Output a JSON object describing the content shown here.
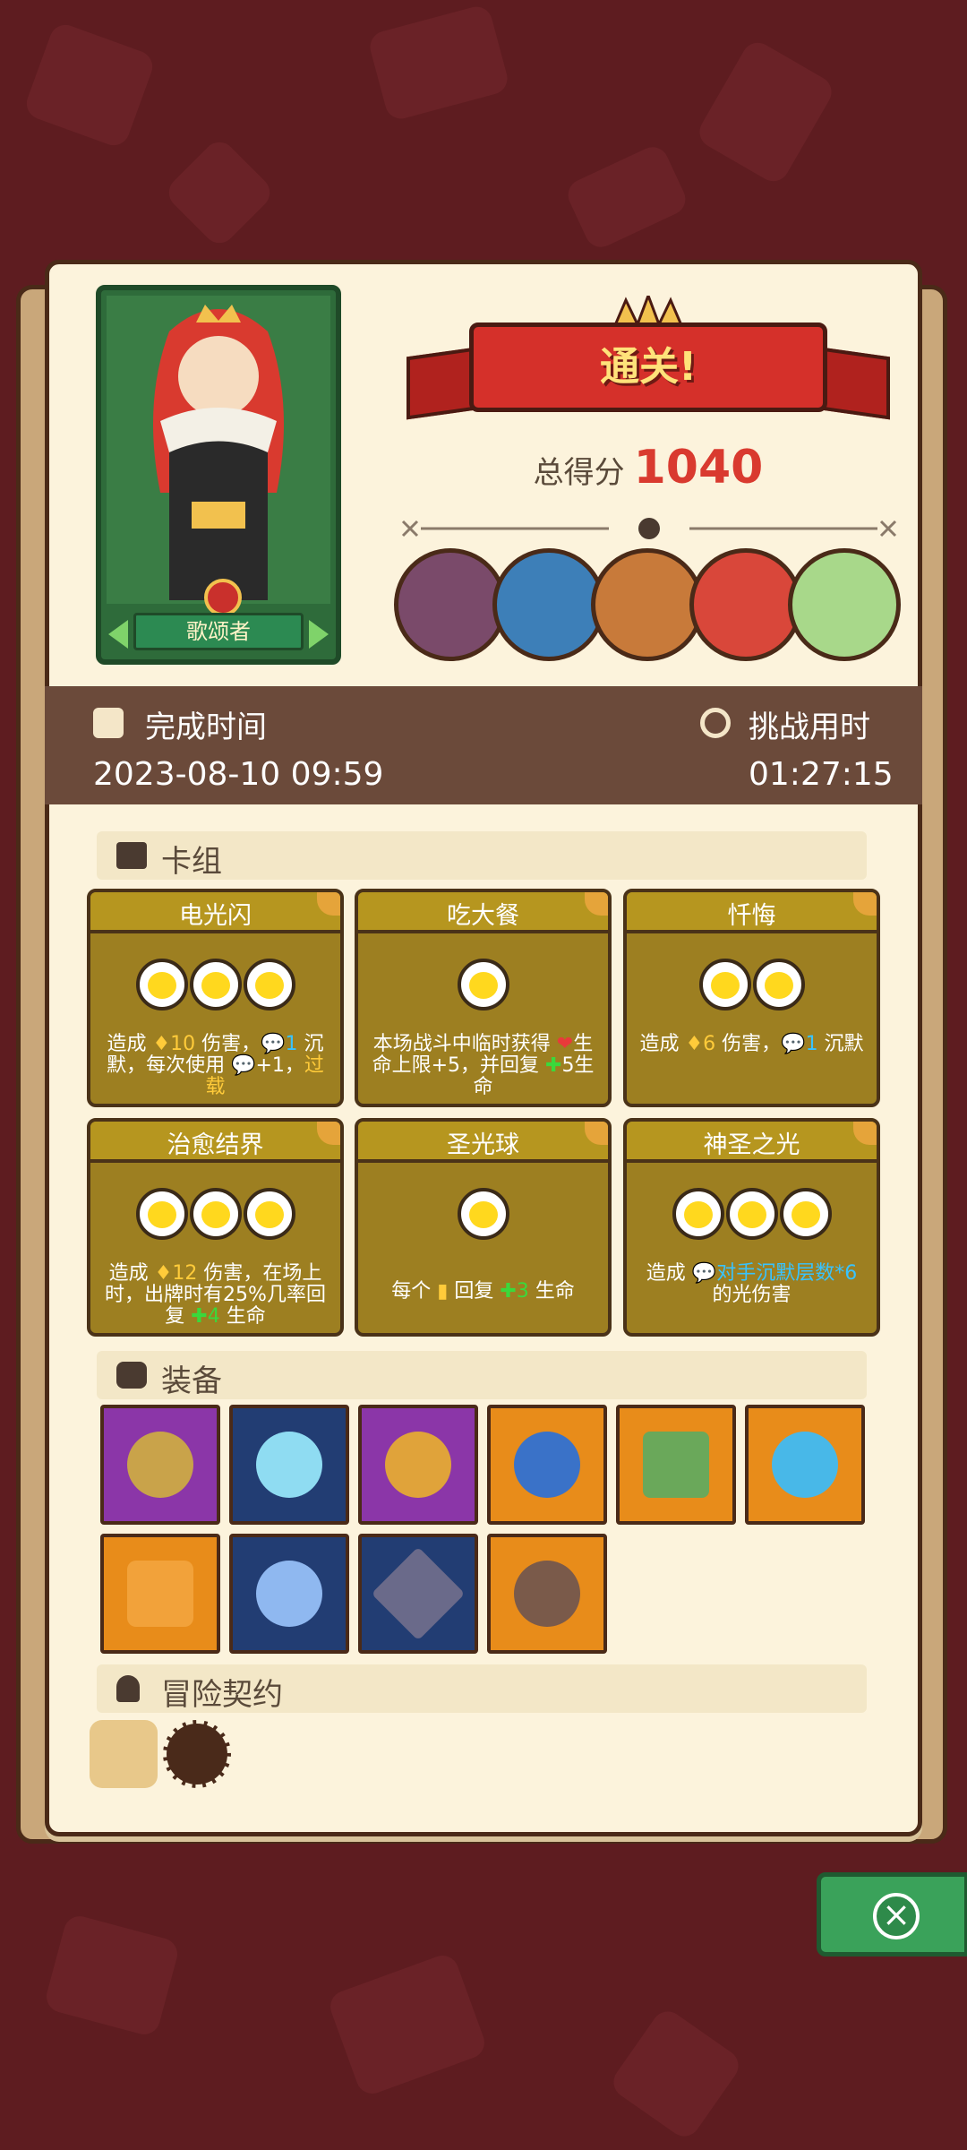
{
  "hero": {
    "name": "歌颂者"
  },
  "result": {
    "banner": "通关!",
    "score_label": "总得分",
    "score_value": "1040"
  },
  "bosses": [
    "boss-1",
    "boss-2",
    "boss-3",
    "boss-4",
    "boss-5"
  ],
  "time": {
    "complete_label": "完成时间",
    "complete_value": "2023-08-10 09:59",
    "challenge_label": "挑战用时",
    "challenge_value": "01:27:15"
  },
  "sections": {
    "deck": "卡组",
    "equipment": "装备",
    "contract": "冒险契约"
  },
  "cards": [
    {
      "name": "电光闪",
      "coins": 3
    },
    {
      "name": "吃大餐",
      "coins": 1
    },
    {
      "name": "忏悔",
      "coins": 2
    },
    {
      "name": "治愈结界",
      "coins": 3
    },
    {
      "name": "圣光球",
      "coins": 1
    },
    {
      "name": "神圣之光",
      "coins": 3
    }
  ],
  "card_desc": {
    "c0_a": "造成 ",
    "c0_n": "♦10",
    "c0_b": " 伤害，",
    "c0_s": "💬1",
    "c0_c": " 沉默，每次使用 ",
    "c0_s2": "💬",
    "c0_d": "+1，",
    "c0_e": "过载",
    "c1_a": "本场战斗中临时获得 ",
    "c1_h": "❤",
    "c1_b": "生命上限+5，并回复 ",
    "c1_p": "✚",
    "c1_c": "5生命",
    "c2_a": "造成 ",
    "c2_n": "♦6",
    "c2_b": " 伤害，",
    "c2_s": "💬1",
    "c2_c": " 沉默",
    "c3_a": "造成 ",
    "c3_n": "♦12",
    "c3_b": " 伤害，在场上时，出牌时有25%几率回复 ",
    "c3_p": "✚4",
    "c3_c": " 生命",
    "c4_a": "每个 ",
    "c4_i": "▮",
    "c4_b": " 回复 ",
    "c4_p": "✚3",
    "c4_c": " 生命",
    "c5_a": "造成 ",
    "c5_s": "💬对手沉默层数*6",
    "c5_b": " 的光伤害"
  },
  "colors": {
    "accent_red": "#d93a2f",
    "card_gold": "#9d7f21",
    "close_green": "#3aa25a"
  },
  "equipment": [
    {
      "icon": "gem-amulet-icon",
      "bg": "purple"
    },
    {
      "icon": "crystal-drop-icon",
      "bg": "navy"
    },
    {
      "icon": "ruby-ring-icon",
      "bg": "purple"
    },
    {
      "icon": "spiked-orb-icon",
      "bg": "navy"
    },
    {
      "icon": "moss-tablet-icon",
      "bg": "orange"
    },
    {
      "icon": "shield-crest-icon",
      "bg": "orange"
    },
    {
      "icon": "woven-tunic-icon",
      "bg": "orange"
    },
    {
      "icon": "star-crystal-ball-icon",
      "bg": "navy"
    },
    {
      "icon": "dark-gem-icon",
      "bg": "navy"
    },
    {
      "icon": "stone-disc-icon",
      "bg": "orange"
    }
  ],
  "contracts": [
    "scroll-icon",
    "horn-icon"
  ]
}
